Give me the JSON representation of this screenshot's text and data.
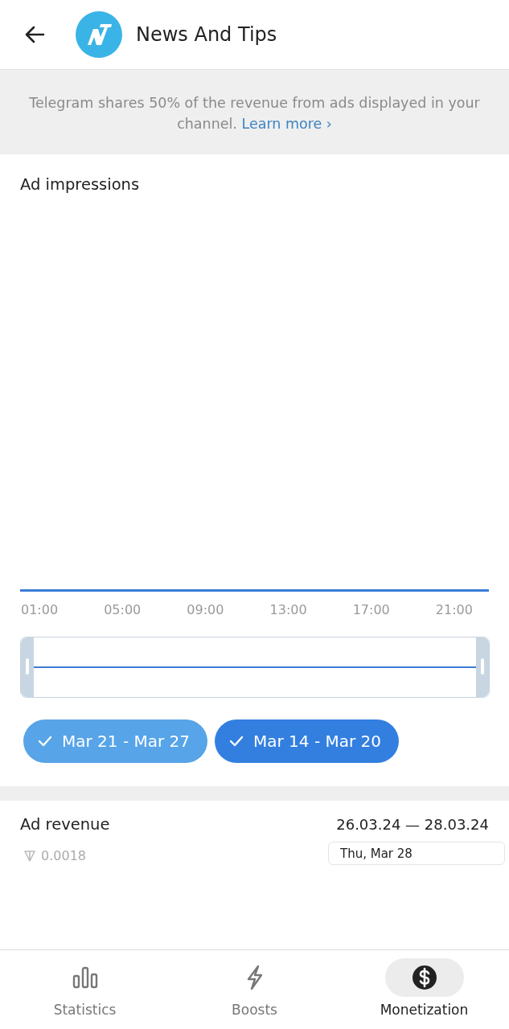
{
  "header": {
    "title": "News And Tips"
  },
  "banner": {
    "text": "Telegram shares 50% of the revenue from ads displayed in your channel.",
    "link": "Learn more",
    "link_icon": "›"
  },
  "impressions": {
    "title": "Ad impressions",
    "x_labels": [
      "01:00",
      "05:00",
      "09:00",
      "13:00",
      "17:00",
      "21:00"
    ],
    "legend": [
      {
        "label": "Mar 21 - Mar 27",
        "checked": true,
        "color": "#57a4e8"
      },
      {
        "label": "Mar 14 - Mar 20",
        "checked": true,
        "color": "#337fe0"
      }
    ]
  },
  "revenue": {
    "title": "Ad revenue",
    "range": "26.03.24 — 28.03.24",
    "value": "0.0018",
    "tooltip": "Thu, Mar 28"
  },
  "nav": [
    {
      "label": "Statistics",
      "kind": "stats",
      "selected": false
    },
    {
      "label": "Boosts",
      "kind": "boost",
      "selected": false
    },
    {
      "label": "Monetization",
      "kind": "money",
      "selected": true
    }
  ]
}
